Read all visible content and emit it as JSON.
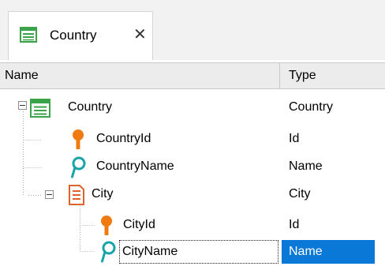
{
  "tab": {
    "label": "Country",
    "close_glyph": "✕",
    "icon": "transaction-table-icon"
  },
  "columns": {
    "name": "Name",
    "type": "Type"
  },
  "rows": [
    {
      "label": "Country",
      "type": "Country",
      "icon": "transaction-table-icon"
    },
    {
      "label": "CountryId",
      "type": "Id",
      "icon": "primary-key-icon"
    },
    {
      "label": "CountryName",
      "type": "Name",
      "icon": "description-attribute-icon"
    },
    {
      "label": "City",
      "type": "City",
      "icon": "sublevel-icon"
    },
    {
      "label": "CityId",
      "type": "Id",
      "icon": "primary-key-icon"
    },
    {
      "label": "CityName",
      "type": "Name",
      "icon": "description-attribute-icon"
    }
  ],
  "colors": {
    "key": "#f07a10",
    "description": "#17a3a8",
    "table": "#3aa34a",
    "level": "#e0622a",
    "selection": "#0a78d6"
  }
}
